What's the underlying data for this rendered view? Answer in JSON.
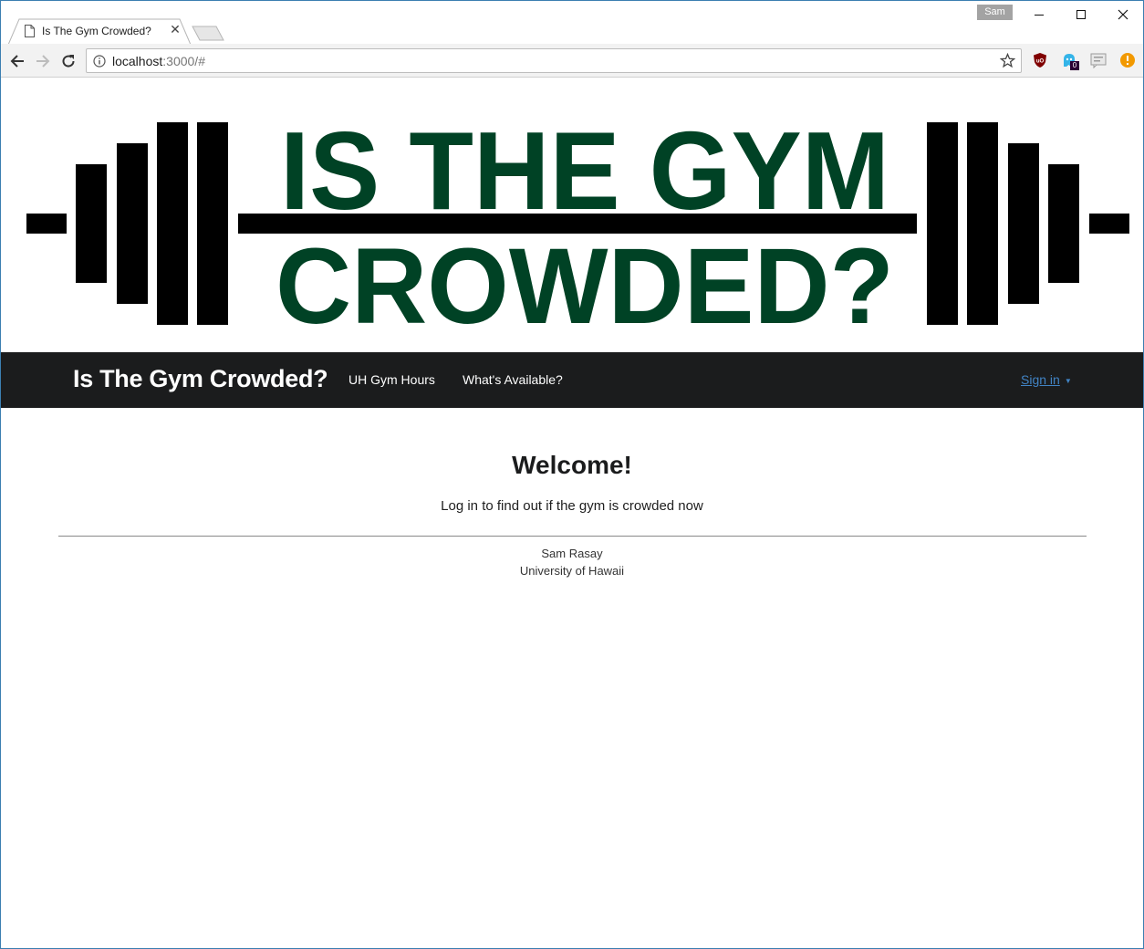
{
  "browser": {
    "tab_title": "Is The Gym Crowded?",
    "tab_close_glyph": "✕",
    "profile_name": "Sam",
    "url_host": "localhost",
    "url_rest": ":3000/#",
    "ghost_badge_count": "0"
  },
  "banner": {
    "line1": "IS THE GYM",
    "line2": "CROWDED?",
    "text_color": "#004225"
  },
  "navbar": {
    "brand": "Is The Gym Crowded?",
    "links": [
      "UH Gym Hours",
      "What's Available?"
    ],
    "signin": "Sign in",
    "signin_caret": "▼",
    "background": "#1b1c1d"
  },
  "main": {
    "heading": "Welcome!",
    "subtitle": "Log in to find out if the gym is crowded now"
  },
  "footer": {
    "name": "Sam Rasay",
    "organization": "University of Hawaii"
  }
}
